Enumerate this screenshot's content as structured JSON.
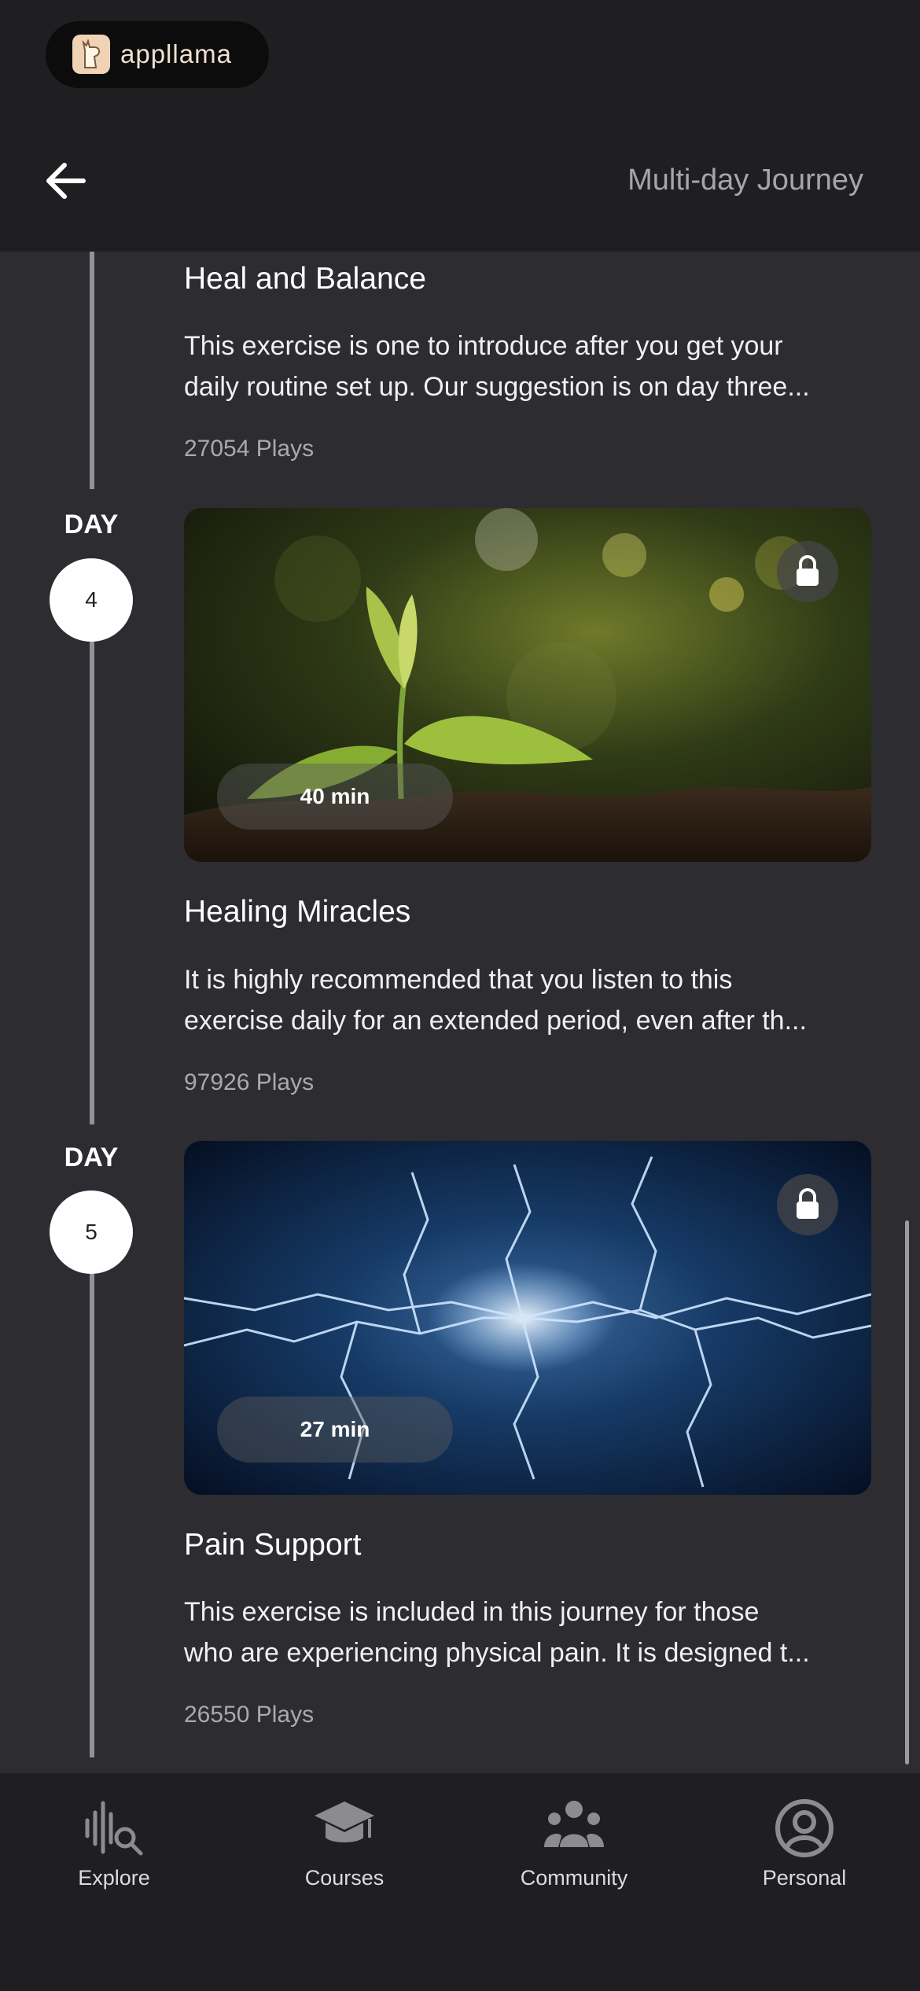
{
  "brand": {
    "name": "appllama",
    "logo_icon": "llama-logo"
  },
  "header": {
    "title": "Multi-day Journey",
    "back_icon": "arrow-left-icon"
  },
  "journey": [
    {
      "title": "Heal and Balance",
      "description_lines": [
        "This exercise is one to introduce after you get your",
        "daily routine set up. Our suggestion is on day three..."
      ],
      "plays": "27054 Plays"
    },
    {
      "day_label": "DAY",
      "day_number": "4",
      "duration": "40 min",
      "locked": true,
      "image": "seedling-sprout-photo",
      "title": "Healing Miracles",
      "description_lines": [
        "It is highly recommended that you listen to this",
        "exercise daily for an extended period, even after th..."
      ],
      "plays": "97926 Plays"
    },
    {
      "day_label": "DAY",
      "day_number": "5",
      "duration": "27 min",
      "locked": true,
      "image": "electric-lightning-photo",
      "title": "Pain Support",
      "description_lines": [
        "This exercise is included in this journey for those",
        "who are experiencing physical pain. It is designed t..."
      ],
      "plays": "26550 Plays"
    }
  ],
  "tabs": [
    {
      "label": "Explore",
      "icon": "explore-search-icon"
    },
    {
      "label": "Courses",
      "icon": "graduation-cap-icon"
    },
    {
      "label": "Community",
      "icon": "community-people-icon"
    },
    {
      "label": "Personal",
      "icon": "person-circle-icon"
    }
  ],
  "colors": {
    "background": "#2c2c31",
    "header": "#1f1f22",
    "timeline": "#8f9399",
    "accent_text": "#f2e0cf"
  }
}
